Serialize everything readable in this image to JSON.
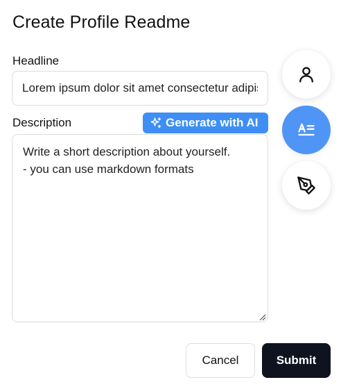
{
  "page": {
    "title": "Create Profile Readme"
  },
  "headline": {
    "label": "Headline",
    "value": "Lorem ipsum dolor sit amet consectetur adipiscing"
  },
  "description": {
    "label": "Description",
    "value": "Write a short description about yourself.\n- you can use markdown formats"
  },
  "ai_button": {
    "label": "Generate with AI",
    "icon": "sparkles-icon"
  },
  "side_nav": [
    {
      "icon": "user-icon",
      "active": false
    },
    {
      "icon": "text-lines-icon",
      "active": true
    },
    {
      "icon": "pen-tool-icon",
      "active": false
    }
  ],
  "actions": {
    "cancel_label": "Cancel",
    "submit_label": "Submit"
  },
  "colors": {
    "accent": "#4f95f6",
    "ai_button": "#3f8ef5",
    "submit": "#0f1320"
  }
}
